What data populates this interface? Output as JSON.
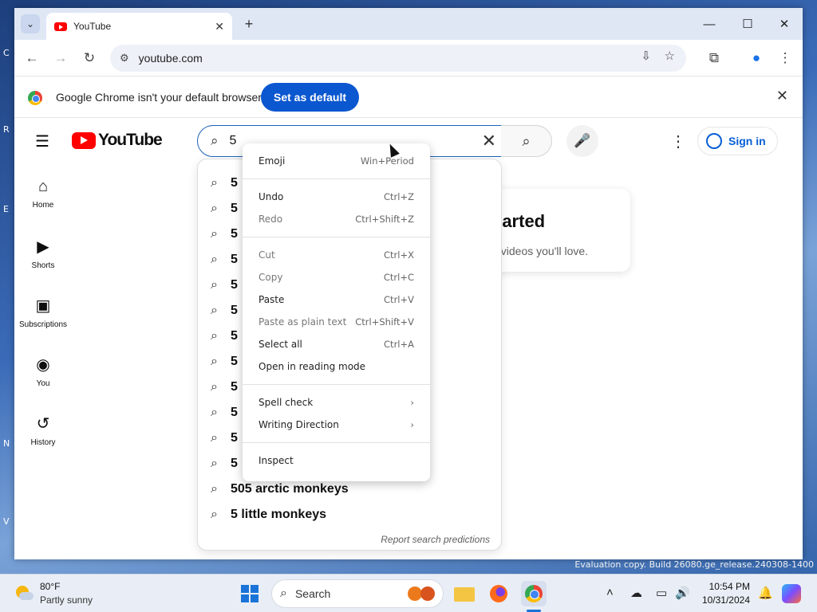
{
  "window": {
    "tab_title": "YouTube",
    "tab_close": "✕",
    "new_tab": "+",
    "minimize": "—",
    "maximize": "☐",
    "close": "✕"
  },
  "toolbar": {
    "url": "youtube.com"
  },
  "infobar": {
    "message": "Google Chrome isn't your default browser",
    "button": "Set as default"
  },
  "youtube": {
    "logo_text": "YouTube",
    "search_value": "5",
    "sign_in": "Sign in",
    "sidebar": [
      {
        "label": "Home",
        "icon": "home-icon"
      },
      {
        "label": "Shorts",
        "icon": "shorts-icon"
      },
      {
        "label": "Subscriptions",
        "icon": "subscriptions-icon"
      },
      {
        "label": "You",
        "icon": "you-icon"
      },
      {
        "label": "History",
        "icon": "history-icon"
      }
    ],
    "card_title": "tarted",
    "card_subtitle": "f videos you'll love.",
    "suggestions": [
      "5",
      "5",
      "5",
      "5",
      "5",
      "5",
      "5",
      "5",
      "5",
      "5",
      "5",
      "5",
      "505 arctic monkeys",
      "5 little monkeys"
    ],
    "report_link": "Report search predictions"
  },
  "context_menu": [
    {
      "label": "Emoji",
      "shortcut": "Win+Period",
      "disabled": false
    },
    {
      "label": "Undo",
      "shortcut": "Ctrl+Z",
      "disabled": false
    },
    {
      "label": "Redo",
      "shortcut": "Ctrl+Shift+Z",
      "disabled": true
    },
    {
      "label": "Cut",
      "shortcut": "Ctrl+X",
      "disabled": true
    },
    {
      "label": "Copy",
      "shortcut": "Ctrl+C",
      "disabled": true
    },
    {
      "label": "Paste",
      "shortcut": "Ctrl+V",
      "disabled": false
    },
    {
      "label": "Paste as plain text",
      "shortcut": "Ctrl+Shift+V",
      "disabled": true
    },
    {
      "label": "Select all",
      "shortcut": "Ctrl+A",
      "disabled": false
    },
    {
      "label": "Open in reading mode",
      "shortcut": "",
      "disabled": false
    },
    {
      "label": "Spell check",
      "shortcut": "›",
      "disabled": false
    },
    {
      "label": "Writing Direction",
      "shortcut": "›",
      "disabled": false
    },
    {
      "label": "Inspect",
      "shortcut": "",
      "disabled": false
    }
  ],
  "watermark": "Evaluation copy. Build 26080.ge_release.240308-1400",
  "taskbar": {
    "temperature": "80°F",
    "weather": "Partly sunny",
    "search_label": "Search",
    "time": "10:54 PM",
    "date": "10/31/2024"
  },
  "colors": {
    "accent": "#0b57d0",
    "youtube_red": "#ff0000",
    "link_blue": "#065fd4"
  }
}
